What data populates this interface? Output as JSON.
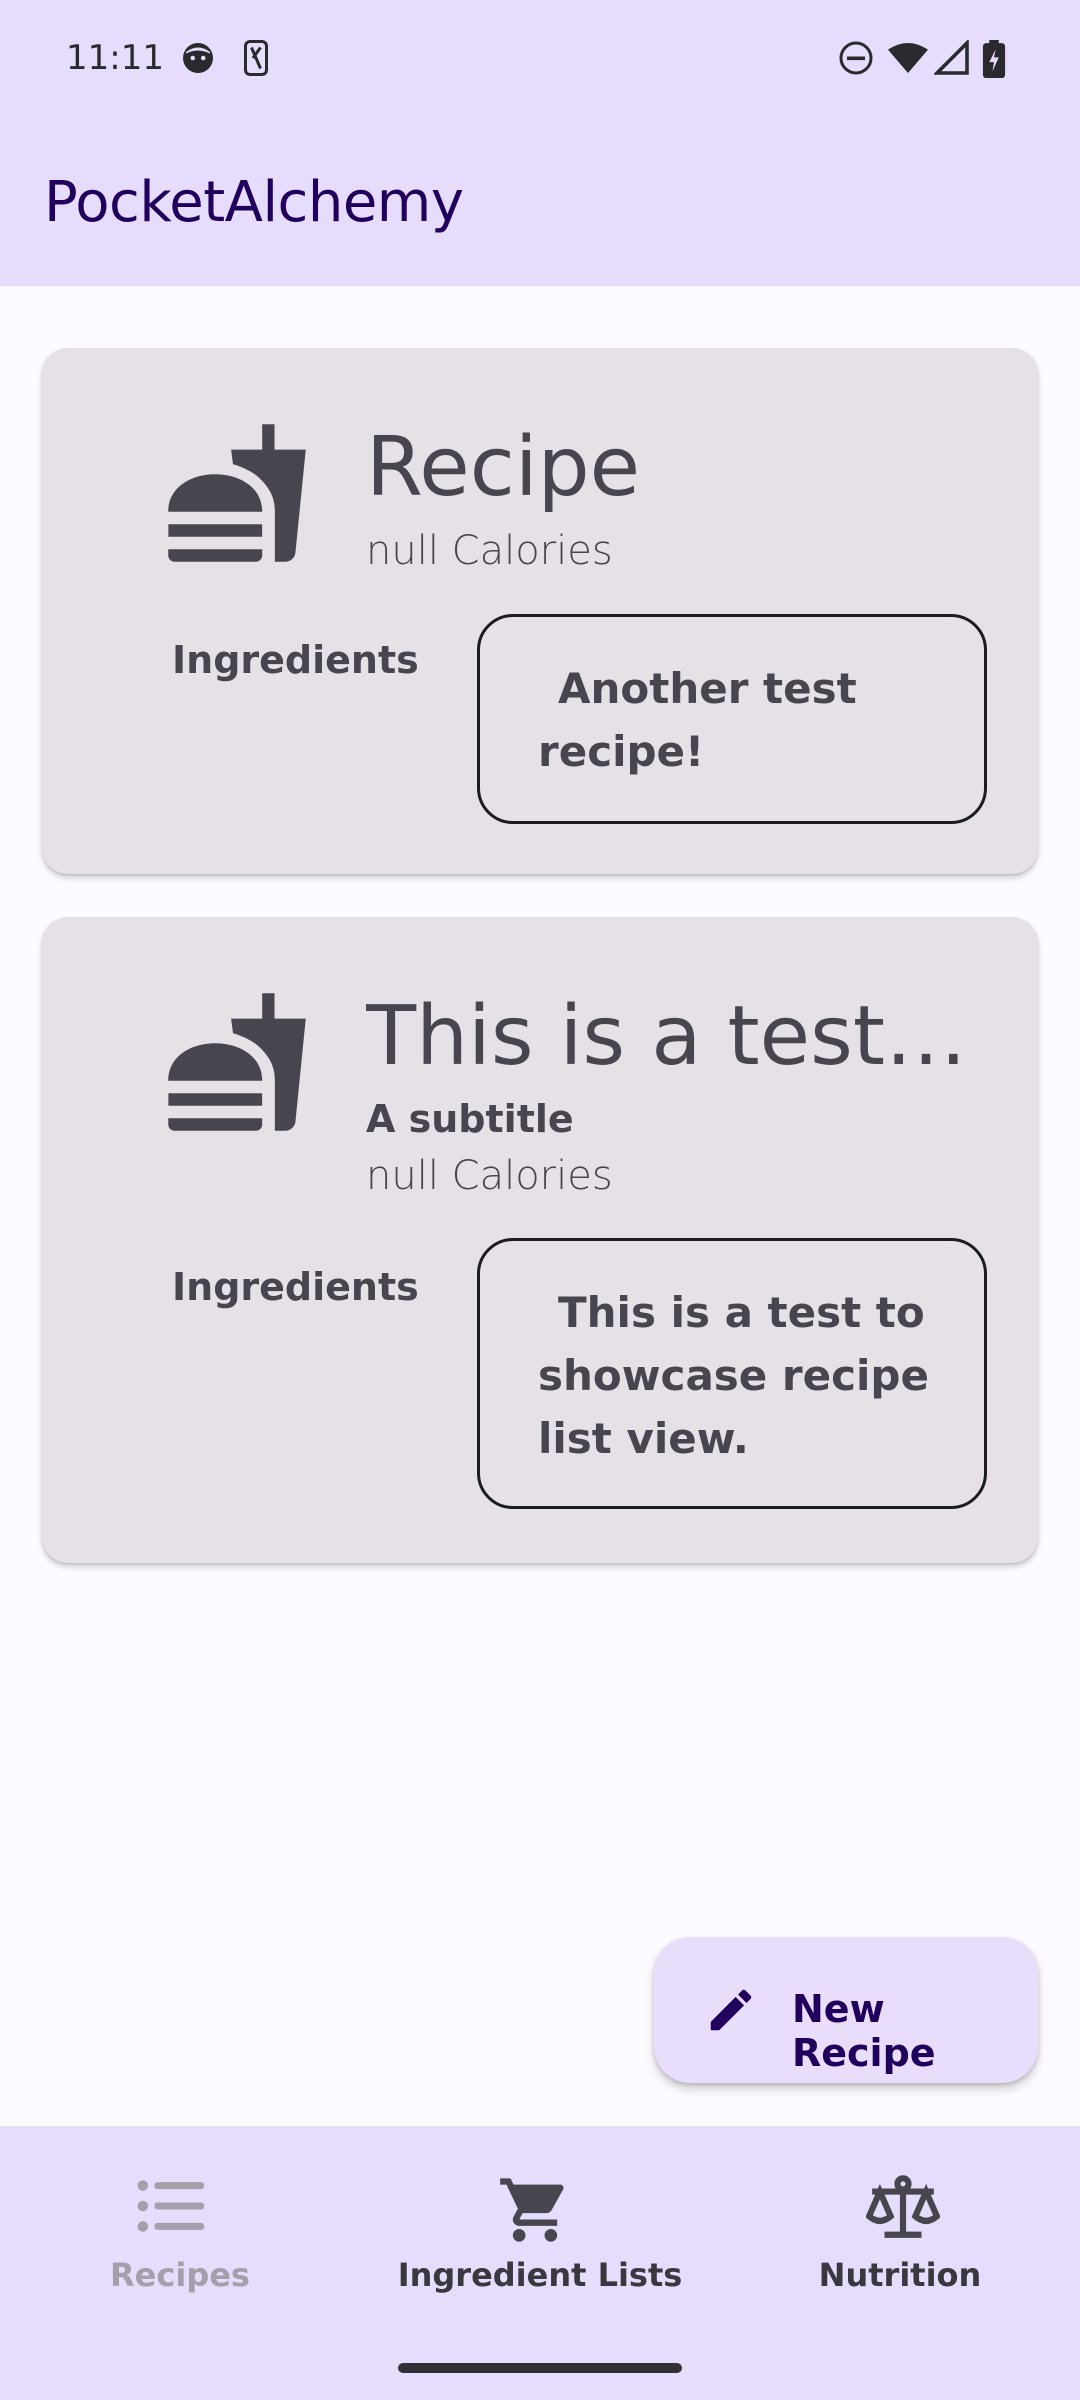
{
  "status_bar": {
    "time": "11:11"
  },
  "app_bar": {
    "title": "PocketAlchemy"
  },
  "recipes": [
    {
      "title": "Recipe",
      "subtitle": "",
      "calories": "null Calories",
      "ingredients_label": "Ingredients",
      "description_lines": [
        "Another test",
        "recipe!"
      ]
    },
    {
      "title": "This is a test r…",
      "subtitle": "A subtitle",
      "calories": "null Calories",
      "ingredients_label": "Ingredients",
      "description_lines": [
        "This is a test to",
        "showcase recipe",
        "list view."
      ]
    }
  ],
  "fab": {
    "label": "New Recipe",
    "icon": "pencil-icon"
  },
  "bottom_nav": {
    "items": [
      {
        "label": "Recipes",
        "icon": "list-icon",
        "state": "disabled"
      },
      {
        "label": "Ingredient Lists",
        "icon": "cart-icon",
        "state": "normal"
      },
      {
        "label": "Nutrition",
        "icon": "scale-icon",
        "state": "normal"
      }
    ]
  },
  "colors": {
    "top_bar": "#e6dcfb",
    "card": "#e6e1e6",
    "on_surface_variant": "#49454f",
    "primary_dark": "#21005d",
    "disabled": "#a49fab"
  }
}
